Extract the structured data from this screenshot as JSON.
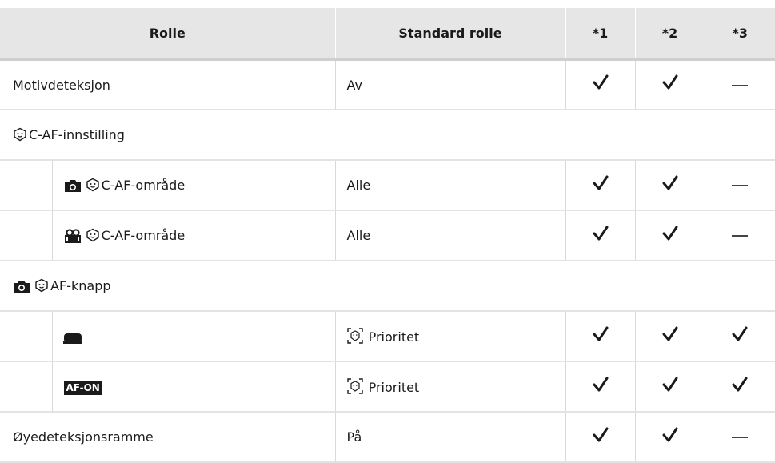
{
  "header": {
    "rolle": "Rolle",
    "standard": "Standard rolle",
    "c1": "*1",
    "c2": "*2",
    "c3": "*3"
  },
  "rows": [
    {
      "name": "Motivdeteksjon",
      "default": "Av",
      "marks": [
        "check",
        "check",
        "dash"
      ]
    },
    {
      "name": "C-AF-innstilling",
      "icons": [
        "face-icon"
      ]
    },
    {
      "name": "C-AF-område",
      "icons": [
        "camera-icon",
        "face-icon"
      ],
      "default": "Alle",
      "marks": [
        "check",
        "check",
        "dash"
      ]
    },
    {
      "name": "C-AF-område",
      "icons": [
        "movie-icon",
        "face-icon"
      ],
      "default": "Alle",
      "marks": [
        "check",
        "check",
        "dash"
      ]
    },
    {
      "name": "AF-knapp",
      "icons": [
        "camera-icon",
        "face-icon"
      ]
    },
    {
      "name": "",
      "icons": [
        "shutter-button-icon"
      ],
      "default": "Prioritet",
      "default_icon": "face-frame-icon",
      "marks": [
        "check",
        "check",
        "check"
      ]
    },
    {
      "name": "",
      "icons": [
        "af-on-button-icon"
      ],
      "icon_text": "AF-ON",
      "default": "Prioritet",
      "default_icon": "face-frame-icon",
      "marks": [
        "check",
        "check",
        "check"
      ]
    },
    {
      "name": "Øyedeteksjonsramme",
      "default": "På",
      "marks": [
        "check",
        "check",
        "dash"
      ]
    }
  ]
}
